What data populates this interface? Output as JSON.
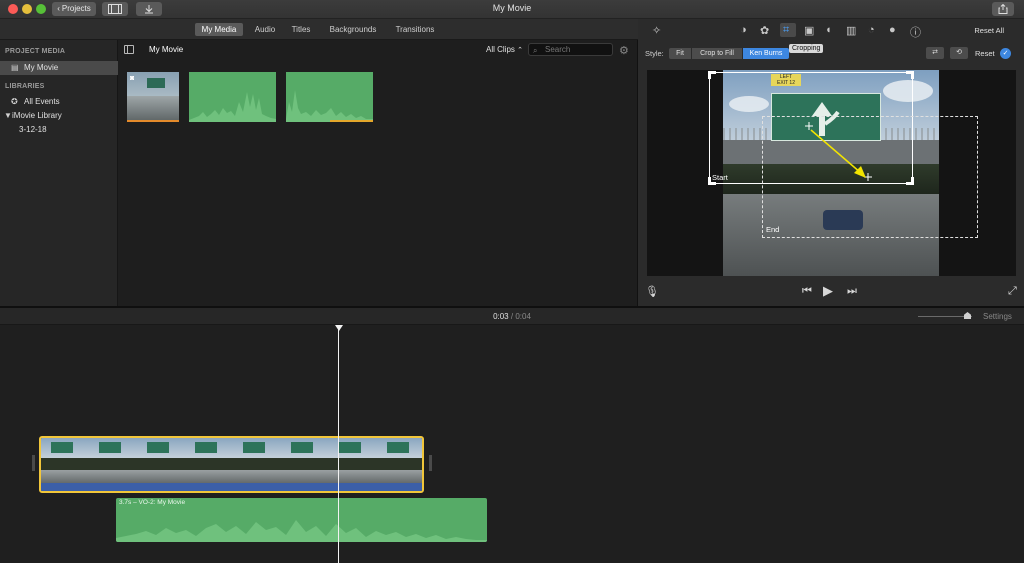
{
  "window": {
    "title": "My Movie",
    "projects_button": "Projects",
    "projects_chevron": "‹",
    "media_icon": "film-icon",
    "import_icon": "import-arrow-icon",
    "share_icon": "share-icon"
  },
  "tabs": [
    {
      "label": "My Media",
      "active": true
    },
    {
      "label": "Audio",
      "active": false
    },
    {
      "label": "Titles",
      "active": false
    },
    {
      "label": "Backgrounds",
      "active": false
    },
    {
      "label": "Transitions",
      "active": false
    }
  ],
  "sidebar": {
    "project_media_header": "PROJECT MEDIA",
    "project_item": "My Movie",
    "libraries_header": "LIBRARIES",
    "all_events": "All Events",
    "library": "iMovie Library",
    "event": "3-12-18"
  },
  "browser": {
    "title": "My Movie",
    "filter": "All Clips",
    "filter_chevron": "⌃",
    "search_placeholder": "Search"
  },
  "viewer": {
    "tooltip": "Cropping",
    "reset_all": "Reset All",
    "style_label": "Style:",
    "styles": [
      "Fit",
      "Crop to Fill",
      "Ken Burns"
    ],
    "active_style": "Ken Burns",
    "reset": "Reset",
    "start_label": "Start",
    "end_label": "End",
    "sign_top": "LEFT",
    "sign_exit": "EXIT 12",
    "tool_icons": [
      "magic-wand-icon",
      "color-balance-icon",
      "color-correction-icon",
      "crop-icon",
      "stabilization-icon",
      "volume-icon",
      "noise-reduction-icon",
      "speed-icon",
      "filter-icon",
      "info-icon"
    ]
  },
  "timeline": {
    "current": "0:03",
    "separator": "/",
    "total": "0:04",
    "settings": "Settings",
    "zoom_level": 0.88,
    "vo_label": "3.7s – VO-2: My Movie"
  }
}
